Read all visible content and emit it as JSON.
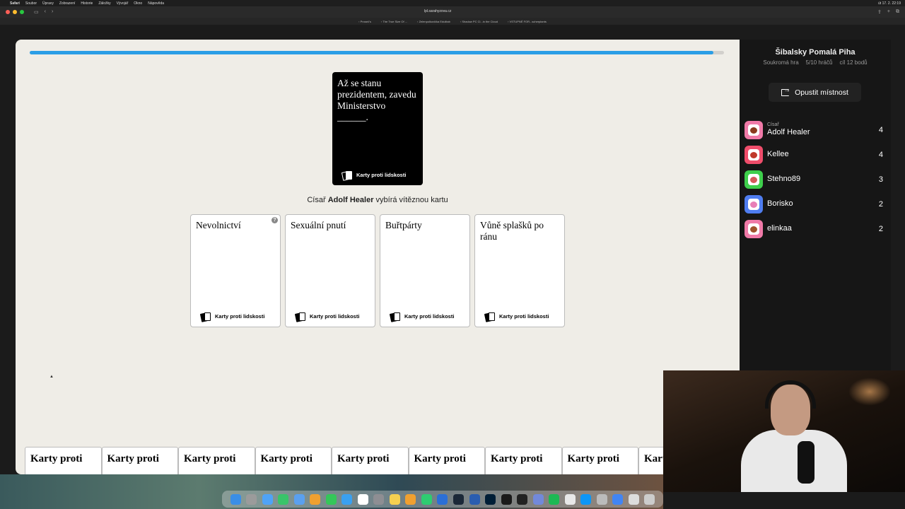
{
  "menubar": {
    "app": "Safari",
    "items": [
      "Soubor",
      "Úpravy",
      "Zobrazení",
      "Historie",
      "Záložky",
      "Vývojář",
      "Okno",
      "Nápověda"
    ],
    "clock": "út 17. 2. 22:19"
  },
  "browser": {
    "url": "lpl.sarahyzova.cz",
    "favorites": [
      "Proseč's",
      "The True Size Of ...",
      "Zelenpolkovička Edulitab",
      "Shadow PC Cl...in the Cloud",
      "VSTUPNÉ FOR...scherplants"
    ]
  },
  "game": {
    "progress_fraction": 0.985,
    "black_card": {
      "text": "Až se stanu prezidentem, zavedu Ministerstvo ______.",
      "brand": "Karty proti lidskosti"
    },
    "status": {
      "prefix": "Císař",
      "name": "Adolf Healer",
      "suffix": "vybírá vítěznou kartu"
    },
    "white_cards": [
      {
        "text": "Nevolnictví",
        "brand": "Karty proti lidskosti",
        "help": "?"
      },
      {
        "text": "Sexuální pnutí",
        "brand": "Karty proti lidskosti"
      },
      {
        "text": "Buřtpárty",
        "brand": "Karty proti lidskosti"
      },
      {
        "text": "Vůně splašků po ránu",
        "brand": "Karty proti lidskosti"
      }
    ],
    "hand_cards": [
      "Karty proti",
      "Karty proti",
      "Karty proti",
      "Karty proti",
      "Karty proti",
      "Karty proti",
      "Karty proti",
      "Karty proti",
      "Karty proti"
    ]
  },
  "sidebar": {
    "room_name": "Šibalsky Pomalá Piha",
    "room_type": "Soukromá hra",
    "players_count": "5/10 hráčů",
    "goal": "cíl 12 bodů",
    "leave_label": "Opustit místnost",
    "players": [
      {
        "role": "Císař",
        "name": "Adolf Healer",
        "score": "4",
        "color": "#f07aa8",
        "face": "#8b3a1e"
      },
      {
        "role": "",
        "name": "Kellee",
        "score": "4",
        "color": "#ef4d6b",
        "face": "#c0392b"
      },
      {
        "role": "",
        "name": "Stehno89",
        "score": "3",
        "color": "#3ecf4c",
        "face": "#d45a5a"
      },
      {
        "role": "",
        "name": "Borisko",
        "score": "2",
        "color": "#4f7df0",
        "face": "#e87fb7"
      },
      {
        "role": "",
        "name": "elinkaa",
        "score": "2",
        "color": "#f07aa8",
        "face": "#a0522d"
      }
    ]
  }
}
